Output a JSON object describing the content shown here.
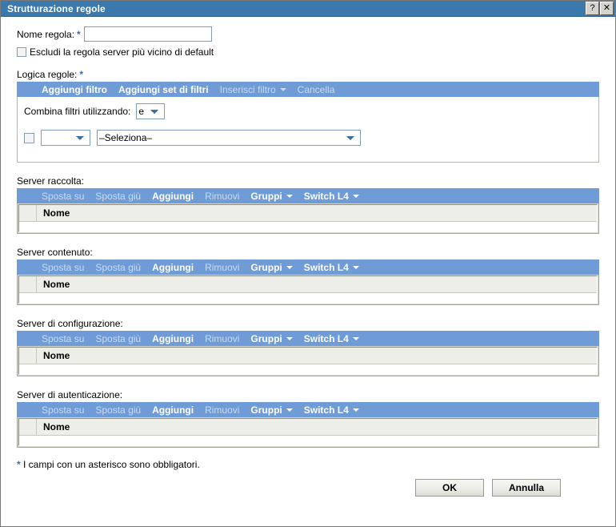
{
  "window": {
    "title": "Strutturazione regole",
    "help_button": "?",
    "close_button": "✕"
  },
  "form": {
    "rule_name_label": "Nome regola:",
    "rule_name_value": "",
    "rule_name_placeholder": "",
    "required_marker": "*",
    "exclude_checkbox_label": "Escludi la regola server più vicino di default",
    "exclude_checkbox_checked": false
  },
  "logic": {
    "section_label": "Logica regole:",
    "required_marker": "*",
    "toolbar": [
      {
        "label": "Aggiungi filtro",
        "enabled": true,
        "has_caret": false
      },
      {
        "label": "Aggiungi set di filtri",
        "enabled": true,
        "has_caret": false
      },
      {
        "label": "Inserisci filtro",
        "enabled": false,
        "has_caret": true
      },
      {
        "label": "Cancella",
        "enabled": false,
        "has_caret": false
      }
    ],
    "combine_label": "Combina filtri utilizzando:",
    "combine_value": "e",
    "combine_options": [
      "e",
      "o"
    ],
    "filter_row": {
      "checked": false,
      "operator_value": "",
      "operator_options": [
        ""
      ],
      "criteria_value": "–Seleziona–",
      "criteria_options": [
        "–Seleziona–"
      ]
    }
  },
  "server_toolbar": [
    {
      "label": "Sposta su",
      "enabled": false,
      "has_caret": false
    },
    {
      "label": "Sposta giù",
      "enabled": false,
      "has_caret": false
    },
    {
      "label": "Aggiungi",
      "enabled": true,
      "has_caret": false
    },
    {
      "label": "Rimuovi",
      "enabled": false,
      "has_caret": false
    },
    {
      "label": "Gruppi",
      "enabled": true,
      "has_caret": true
    },
    {
      "label": "Switch L4",
      "enabled": true,
      "has_caret": true
    }
  ],
  "column_header_name": "Nome",
  "sections": [
    {
      "label": "Server raccolta:",
      "rows": []
    },
    {
      "label": "Server contenuto:",
      "rows": []
    },
    {
      "label": "Server di configurazione:",
      "rows": []
    },
    {
      "label": "Server di autenticazione:",
      "rows": []
    }
  ],
  "footer": {
    "note_star": "*",
    "note_text": " I campi con un asterisco sono obbligatori.",
    "ok_label": "OK",
    "cancel_label": "Annulla"
  },
  "colors": {
    "titlebar": "#3b78ab",
    "toolbar": "#6f9bd6",
    "accent": "#3b6ea5",
    "table_header": "#eeeee8",
    "panel_border": "#b5b5ae"
  }
}
